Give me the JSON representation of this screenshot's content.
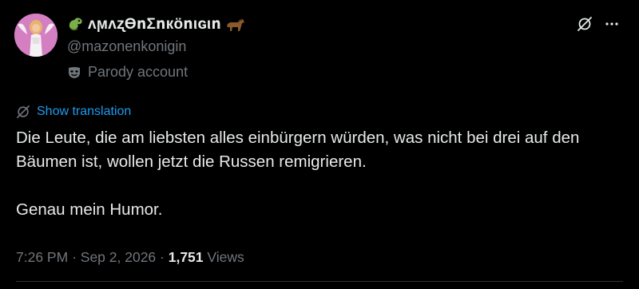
{
  "author": {
    "display_name": "ʌϻʌʐϴոΣոкöոιɢιո",
    "handle": "@mazonenkonigin",
    "badge_label": "Parody account",
    "avatar_icon": "avatar-image",
    "prefix_emoji": "dragon-emoji",
    "suffix_emoji": "horse-emoji"
  },
  "actions": {
    "grok_icon": "grok-icon",
    "more_icon": "more-icon"
  },
  "translation": {
    "label": "Show translation"
  },
  "post": {
    "paragraph_1": "Die Leute, die am liebsten alles einbürgern würden, was nicht bei drei auf den Bäumen ist, wollen jetzt die Russen remigrieren.",
    "paragraph_2": "Genau mein Humor."
  },
  "meta": {
    "time": "7:26 PM",
    "separator": "·",
    "date": "Sep 2, 2026",
    "views_count": "1,751",
    "views_label": "Views"
  },
  "colors": {
    "background": "#000000",
    "text_primary": "#e7e9ea",
    "text_secondary": "#71767b",
    "accent": "#1d9bf0"
  }
}
